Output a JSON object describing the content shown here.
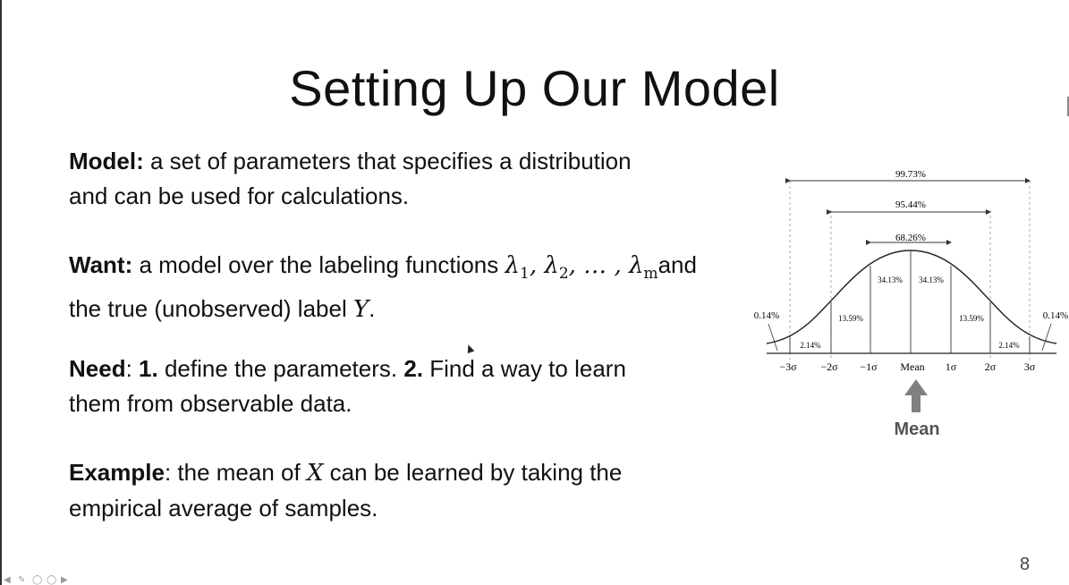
{
  "slide": {
    "title": "Setting Up Our Model",
    "page_number": "8"
  },
  "model": {
    "label": "Model:",
    "text_line1": " a set of parameters that specifies a distribution",
    "text_line2": "and can be used for calculations."
  },
  "want": {
    "label": "Want:",
    "text_before": " a model over the labeling functions ",
    "lambda": "λ",
    "sub1": "1",
    "sub2": "2",
    "ellipsis": ", … , ",
    "subm": "m",
    "text_after": "and",
    "text_line2_before": "the true (unobserved) label ",
    "y_var": "Y",
    "text_line2_after": "."
  },
  "need": {
    "label": "Need",
    "colon": ": ",
    "step1_num": "1.",
    "step1_text": " define the parameters. ",
    "step2_num": "2.",
    "step2_text": " Find a way to learn",
    "line2": "them from observable data."
  },
  "example": {
    "label": "Example",
    "text_before": ": the mean of ",
    "x_var": "X",
    "text_after": " can be learned by taking the",
    "line2": "empirical average of samples."
  },
  "figure": {
    "pct_outer": "99.73%",
    "pct_middle": "95.44%",
    "pct_inner": "68.26%",
    "pct_center_left": "34.13%",
    "pct_center_right": "34.13%",
    "pct_13_left": "13.59%",
    "pct_13_right": "13.59%",
    "pct_2_left": "2.14%",
    "pct_2_right": "2.14%",
    "pct_tail_left": "0.14%",
    "pct_tail_right": "0.14%",
    "ticks": [
      "−3σ",
      "−2σ",
      "−1σ",
      "Mean",
      "1σ",
      "2σ",
      "3σ"
    ],
    "arrow_label": "Mean"
  }
}
